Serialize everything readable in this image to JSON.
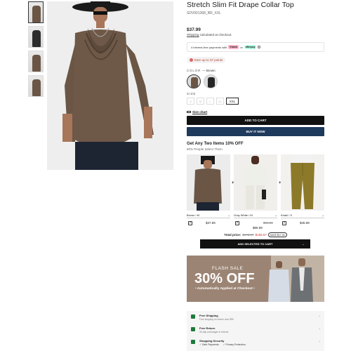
{
  "product": {
    "title": "Stretch Slim Fit Drape Collar Top",
    "sku": "SDV001368_BR_XXL",
    "price": "$37.99",
    "shipping_prefix": "Shipping",
    "shipping_suffix": " calculated at checkout.",
    "installments": "4 interest-free payments with",
    "klarna": "Klarna",
    "or": "or",
    "afterpay": "afterpay",
    "points": "Earn up to 37 points",
    "color_label": "COLOR",
    "color_value": "— Brown",
    "size_label": "SIZE",
    "sizes": [
      "S",
      "M",
      "L",
      "XL",
      "XXL"
    ],
    "selected_size": "XXL",
    "size_chart": "Size chart",
    "add_to_cart": "ADD TO CART",
    "buy_now": "BUY IT NOW"
  },
  "bundle": {
    "title": "Get Any Two Items 10% OFF",
    "subtitle": "80% People Select Them",
    "items": [
      {
        "variant": "Brown / M",
        "price": "$37.99",
        "old_price": ""
      },
      {
        "variant": "Gray White / M",
        "price": "$89.99",
        "old_price": "$94.99"
      },
      {
        "variant": "Khaki / S",
        "price": "$45.99",
        "old_price": ""
      }
    ],
    "total_label": "Total price:",
    "total_old": "$173.97",
    "total_new": "$156.57",
    "save": "SAVE $17.40",
    "add_selected": "ADD SELECTED TO CART"
  },
  "flash": {
    "label": "FLASH SALE",
    "percent": "30% OFF",
    "sub": "• Automatically Applied at Checkout •"
  },
  "services": [
    {
      "title": "Free Shipping",
      "sub": "Free shipping on orders over $99"
    },
    {
      "title": "Free Return",
      "sub": "30-day exchanges & returns"
    },
    {
      "title": "Shopping Security",
      "tags": [
        "Safe Payments",
        "Privacy Protection"
      ]
    }
  ]
}
